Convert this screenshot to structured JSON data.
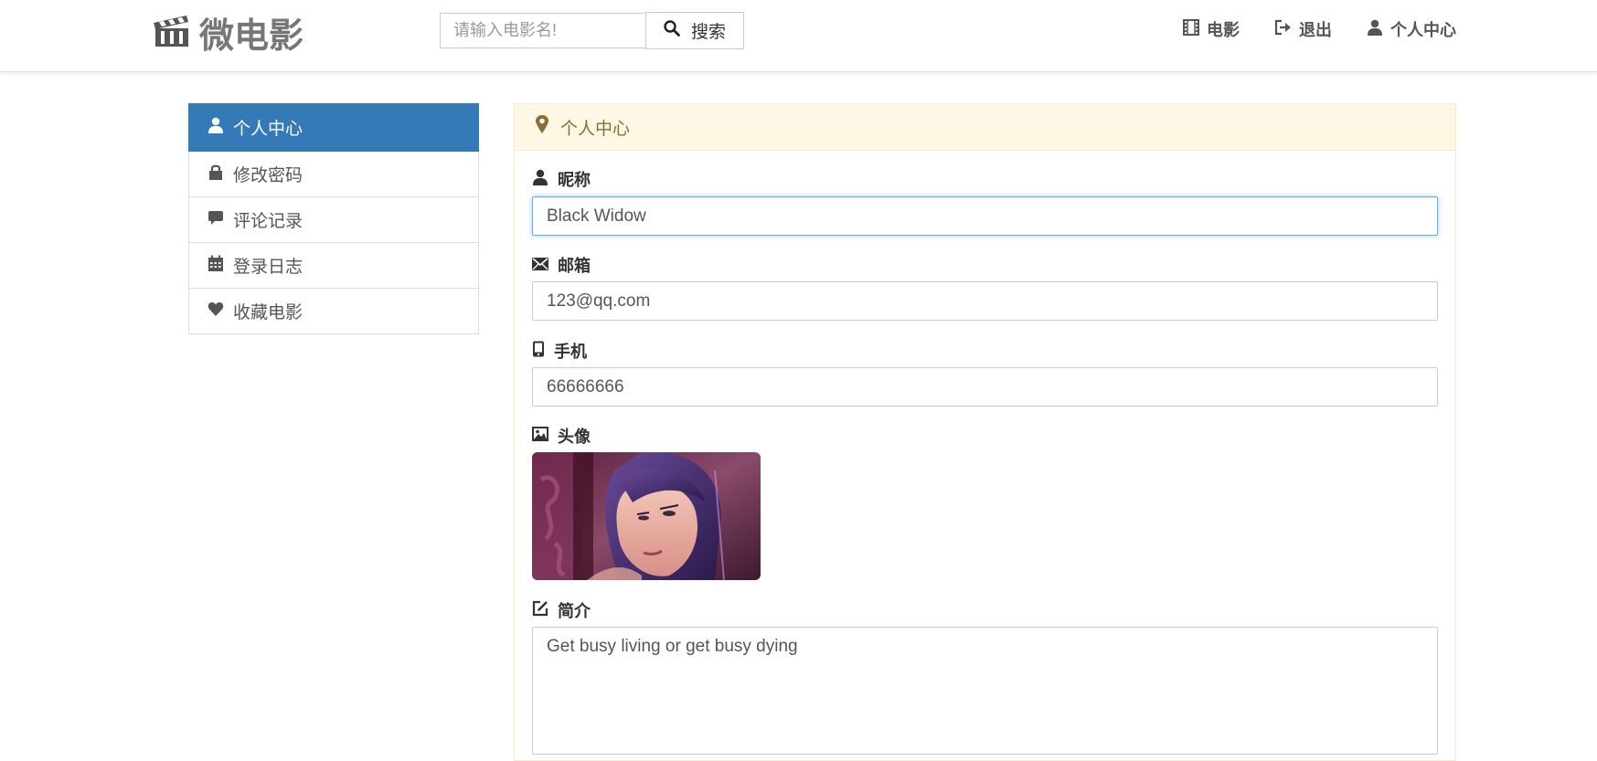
{
  "brand": {
    "name": "微电影",
    "icon": "clapperboard-icon"
  },
  "search": {
    "placeholder": "请输入电影名!",
    "button_label": "搜索",
    "icon": "search-icon"
  },
  "nav": {
    "items": [
      {
        "label": "电影",
        "icon": "film-icon"
      },
      {
        "label": "退出",
        "icon": "logout-icon"
      },
      {
        "label": "个人中心",
        "icon": "user-icon"
      }
    ]
  },
  "sidebar": {
    "items": [
      {
        "label": "个人中心",
        "icon": "user-icon",
        "active": true
      },
      {
        "label": "修改密码",
        "icon": "lock-icon",
        "active": false
      },
      {
        "label": "评论记录",
        "icon": "comment-icon",
        "active": false
      },
      {
        "label": "登录日志",
        "icon": "calendar-icon",
        "active": false
      },
      {
        "label": "收藏电影",
        "icon": "heart-icon",
        "active": false
      }
    ],
    "active_color": "#337ab7"
  },
  "panel": {
    "title": "个人中心",
    "title_icon": "map-marker-icon",
    "fields": {
      "nickname": {
        "label": "昵称",
        "value": "Black Widow",
        "icon": "user-icon"
      },
      "email": {
        "label": "邮箱",
        "value": "123@qq.com",
        "icon": "envelope-icon"
      },
      "phone": {
        "label": "手机",
        "value": "66666666",
        "icon": "phone-icon"
      },
      "avatar": {
        "label": "头像",
        "icon": "picture-icon"
      },
      "bio": {
        "label": "简介",
        "value": "Get busy living or get busy dying",
        "icon": "edit-icon"
      }
    },
    "header_bg": "#fcf8e3",
    "header_color": "#8a6d3b"
  }
}
